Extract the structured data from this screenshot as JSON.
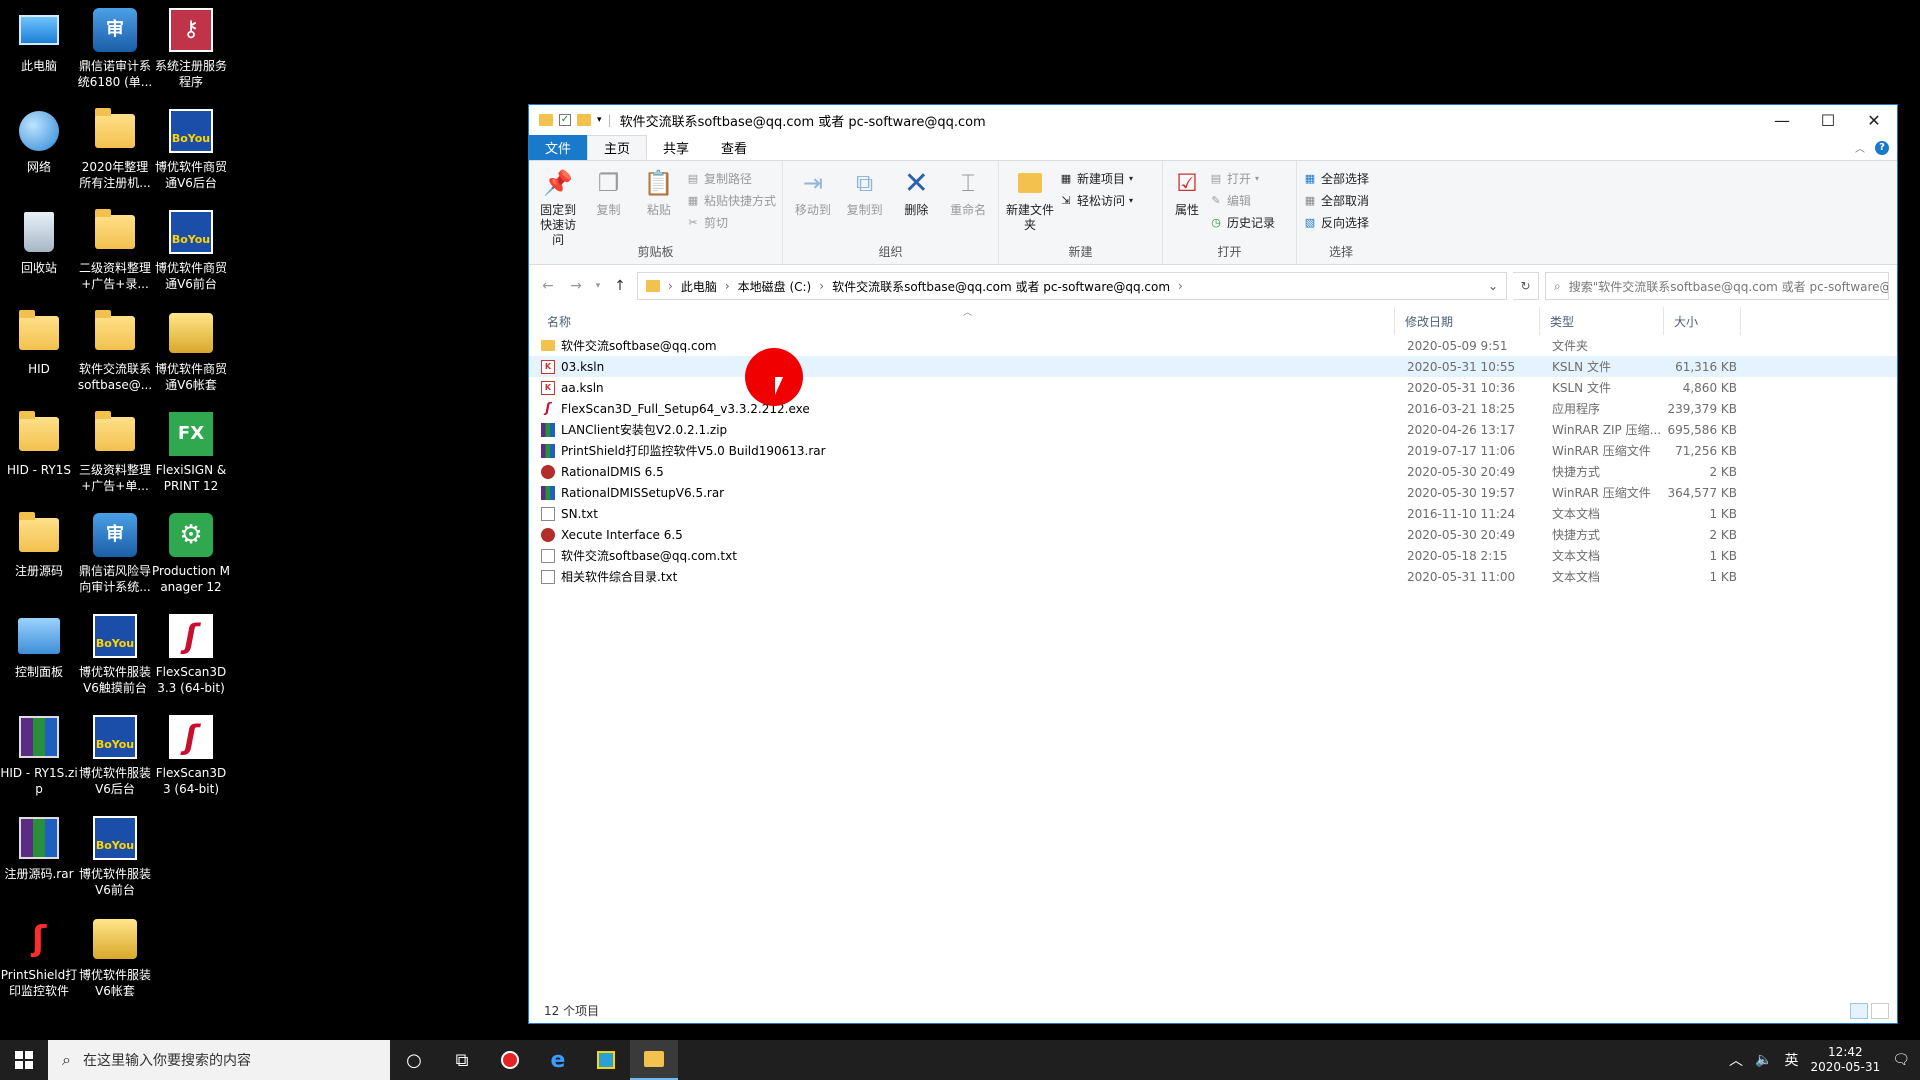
{
  "desktop": {
    "icons": [
      {
        "label": "此电脑",
        "icon": "this-pc-icon"
      },
      {
        "label": "鼎信诺审计系统6180 (单...",
        "icon": "audit-app-icon"
      },
      {
        "label": "系统注册服务程序",
        "icon": "registration-key-icon"
      },
      {
        "label": "网络",
        "icon": "network-icon"
      },
      {
        "label": "2020年整理所有注册机...",
        "icon": "folder-icon"
      },
      {
        "label": "博优软件商贸通V6后台",
        "icon": "boyou-icon"
      },
      {
        "label": "回收站",
        "icon": "recycle-bin-icon"
      },
      {
        "label": "二级资料整理+广告+录...",
        "icon": "folder-icon"
      },
      {
        "label": "博优软件商贸通V6前台",
        "icon": "boyou-icon"
      },
      {
        "label": "HID",
        "icon": "folder-icon"
      },
      {
        "label": "软件交流联系softbase@...",
        "icon": "folder-icon"
      },
      {
        "label": "博优软件商贸通V6帐套",
        "icon": "package-icon"
      },
      {
        "label": "HID - RY1S",
        "icon": "folder-icon"
      },
      {
        "label": "三级资料整理+广告+单...",
        "icon": "folder-icon"
      },
      {
        "label": "FlexiSIGN & PRINT 12",
        "icon": "flexisign-icon"
      },
      {
        "label": "注册源码",
        "icon": "folder-icon"
      },
      {
        "label": "鼎信诺风险导向审计系统...",
        "icon": "audit-app-icon"
      },
      {
        "label": "Production Manager 12",
        "icon": "gear-icon"
      },
      {
        "label": "控制面板",
        "icon": "control-panel-icon"
      },
      {
        "label": "博优软件服装V6触摸前台",
        "icon": "boyou-icon"
      },
      {
        "label": "FlexScan3D 3.3 (64-bit)",
        "icon": "flexscan-icon"
      },
      {
        "label": "HID - RY1S.zip",
        "icon": "winrar-icon"
      },
      {
        "label": "博优软件服装V6后台",
        "icon": "boyou-icon"
      },
      {
        "label": "FlexScan3D 3 (64-bit)",
        "icon": "flexscan-icon"
      },
      {
        "label": "注册源码.rar",
        "icon": "winrar-icon"
      },
      {
        "label": "博优软件服装V6前台",
        "icon": "boyou-icon"
      },
      {
        "label": "PrintShield打印监控软件",
        "icon": "printshield-icon"
      },
      {
        "label": "博优软件服装V6帐套",
        "icon": "package-icon"
      }
    ]
  },
  "window": {
    "title": "软件交流联系softbase@qq.com 或者 pc-software@qq.com",
    "controls": {
      "minimize": "—",
      "maximize": "☐",
      "close": "✕"
    },
    "tabs": {
      "file": "文件",
      "home": "主页",
      "share": "共享",
      "view": "查看"
    },
    "ribbon": {
      "clipboard": {
        "name": "剪贴板",
        "pin": "固定到快速访问",
        "copy": "复制",
        "paste": "粘贴",
        "copy_path": "复制路径",
        "paste_shortcut": "粘贴快捷方式",
        "cut": "剪切"
      },
      "organize": {
        "name": "组织",
        "move_to": "移动到",
        "copy_to": "复制到",
        "delete": "删除",
        "rename": "重命名"
      },
      "new": {
        "name": "新建",
        "new_folder": "新建文件夹",
        "new_item": "新建项目",
        "easy_access": "轻松访问"
      },
      "open": {
        "name": "打开",
        "properties": "属性",
        "open": "打开",
        "edit": "编辑",
        "history": "历史记录"
      },
      "select": {
        "name": "选择",
        "select_all": "全部选择",
        "select_none": "全部取消",
        "invert": "反向选择"
      }
    },
    "address": {
      "crumbs": [
        "此电脑",
        "本地磁盘 (C:)",
        "软件交流联系softbase@qq.com 或者 pc-software@qq.com"
      ],
      "search_placeholder": "搜索\"软件交流联系softbase@qq.com 或者 pc-software@qq...."
    },
    "columns": {
      "name": "名称",
      "date": "修改日期",
      "type": "类型",
      "size": "大小"
    },
    "files": [
      {
        "name": "软件交流softbase@qq.com",
        "date": "2020-05-09 9:51",
        "type": "文件夹",
        "size": "",
        "icon": "folder"
      },
      {
        "name": "03.ksln",
        "date": "2020-05-31 10:55",
        "type": "KSLN 文件",
        "size": "61,316 KB",
        "icon": "kslan"
      },
      {
        "name": "aa.ksln",
        "date": "2020-05-31 10:36",
        "type": "KSLN 文件",
        "size": "4,860 KB",
        "icon": "kslan"
      },
      {
        "name": "FlexScan3D_Full_Setup64_v3.3.2.212.exe",
        "date": "2016-03-21 18:25",
        "type": "应用程序",
        "size": "239,379 KB",
        "icon": "exe"
      },
      {
        "name": "LANClient安装包V2.0.2.1.zip",
        "date": "2020-04-26 13:17",
        "type": "WinRAR ZIP 压缩...",
        "size": "695,586 KB",
        "icon": "rar"
      },
      {
        "name": "PrintShield打印监控软件V5.0 Build190613.rar",
        "date": "2019-07-17 11:06",
        "type": "WinRAR 压缩文件",
        "size": "71,256 KB",
        "icon": "rar"
      },
      {
        "name": "RationalDMIS 6.5",
        "date": "2020-05-30 20:49",
        "type": "快捷方式",
        "size": "2 KB",
        "icon": "lnk"
      },
      {
        "name": "RationalDMISSetupV6.5.rar",
        "date": "2020-05-30 19:57",
        "type": "WinRAR 压缩文件",
        "size": "364,577 KB",
        "icon": "rar"
      },
      {
        "name": "SN.txt",
        "date": "2016-11-10 11:24",
        "type": "文本文档",
        "size": "1 KB",
        "icon": "txt"
      },
      {
        "name": "Xecute Interface 6.5",
        "date": "2020-05-30 20:49",
        "type": "快捷方式",
        "size": "2 KB",
        "icon": "lnk"
      },
      {
        "name": "软件交流softbase@qq.com.txt",
        "date": "2020-05-18 2:15",
        "type": "文本文档",
        "size": "1 KB",
        "icon": "txt"
      },
      {
        "name": "相关软件综合目录.txt",
        "date": "2020-05-31 11:00",
        "type": "文本文档",
        "size": "1 KB",
        "icon": "txt"
      }
    ],
    "status": "12 个项目"
  },
  "taskbar": {
    "search_placeholder": "在这里输入你要搜索的内容",
    "ime": "英",
    "time": "12:42",
    "date": "2020-05-31"
  }
}
